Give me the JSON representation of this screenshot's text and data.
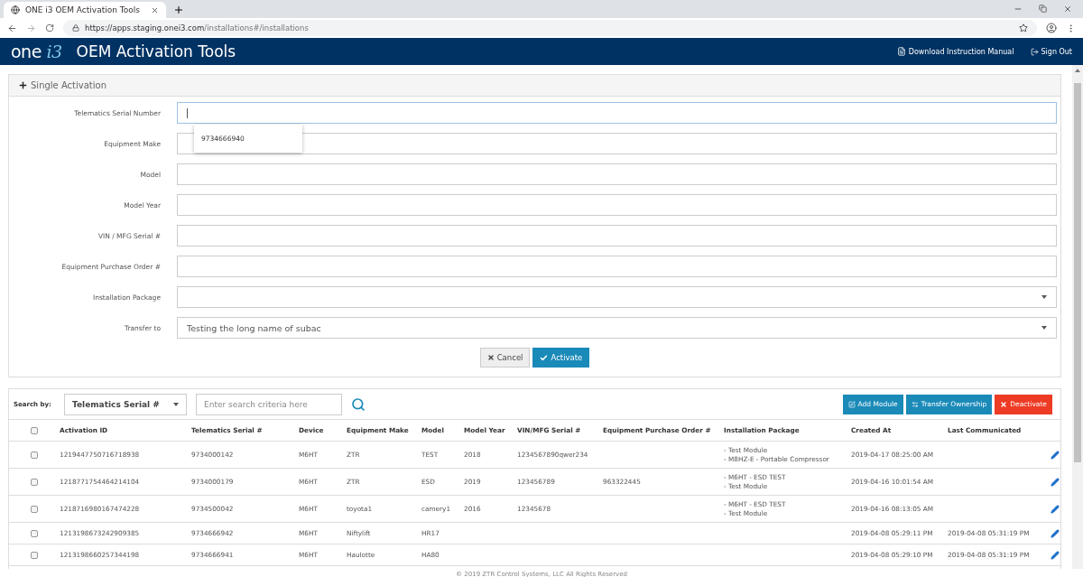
{
  "browser": {
    "tab_title": "ONE i3 OEM Activation Tools",
    "url_host": "https://apps.staging.onei3.com",
    "url_path": "/installations#/installations"
  },
  "header": {
    "logo": {
      "word": "one",
      "mark": "i3"
    },
    "title": "OEM Activation Tools",
    "links": [
      {
        "kind": "pdf",
        "label": "Download Instruction Manual"
      },
      {
        "kind": "signout",
        "label": "Sign Out"
      }
    ]
  },
  "single_activation": {
    "title": "Single Activation",
    "expanded": true,
    "fields": [
      {
        "kind": "text",
        "label": "Telematics Serial Number",
        "focused": true,
        "suggestion": "9734666940"
      },
      {
        "kind": "text",
        "label": "Equipment Make",
        "focused": false
      },
      {
        "kind": "text",
        "label": "Model",
        "focused": false
      },
      {
        "kind": "text",
        "label": "Model Year",
        "focused": false
      },
      {
        "kind": "text",
        "label": "VIN / MFG Serial #",
        "focused": false
      },
      {
        "kind": "text",
        "label": "Equipment Purchase Order #",
        "focused": false
      },
      {
        "kind": "select",
        "label": "Installation Package",
        "focused": false
      },
      {
        "kind": "select",
        "label": "Transfer to",
        "value": "Testing the long name of subac",
        "focused": false
      }
    ],
    "buttons": [
      {
        "kind": "cancel",
        "label": "Cancel"
      },
      {
        "kind": "activate",
        "label": "Activate"
      }
    ]
  },
  "search": {
    "label": "Search by:",
    "field": "Telematics Serial #",
    "placeholder": "Enter search criteria here"
  },
  "actions": [
    {
      "kind": "edit",
      "label": "Add Module",
      "color": "#1a8ab8"
    },
    {
      "kind": "transfer",
      "label": "Transfer Ownership",
      "color": "#1a8ab8"
    },
    {
      "kind": "delete",
      "label": "Deactivate",
      "color": "#ee3b24"
    }
  ],
  "table": {
    "columns": [
      "Activation ID",
      "Telematics Serial #",
      "Device",
      "Equipment Make",
      "Model",
      "Model Year",
      "VIN/MFG Serial #",
      "Equipment Purchase Order #",
      "Installation Package",
      "Created At",
      "Last Communicated"
    ],
    "all_checked": false,
    "rows": [
      {
        "checked": false,
        "cells": [
          "1219447750716718938",
          "9734000142",
          "M6HT",
          "ZTR",
          "TEST",
          "2018",
          "1234567890qwer234",
          "",
          [
            "- Test Module",
            "- M8HZ-E - Portable Compressor"
          ],
          "2019-04-17 08:25:00 AM",
          ""
        ]
      },
      {
        "checked": false,
        "cells": [
          "1218771754464214104",
          "9734000179",
          "M6HT",
          "ZTR",
          "ESD",
          "2019",
          "123456789",
          "963322445",
          [
            "- M6HT - ESD TEST",
            "- Test Module"
          ],
          "2019-04-16 10:01:54 AM",
          ""
        ]
      },
      {
        "checked": false,
        "cells": [
          "1218716980167474228",
          "9734500042",
          "M6HT",
          "toyota1",
          "camery1",
          "2016",
          "12345678",
          "",
          [
            "- M6HT - ESD TEST",
            "- Test Module"
          ],
          "2019-04-16 08:13:05 AM",
          ""
        ]
      },
      {
        "checked": false,
        "cells": [
          "1213198673242909385",
          "9734666942",
          "M6HT",
          "Niftylift",
          "HR17",
          "",
          "",
          "",
          [],
          "2019-04-08 05:29:11 PM",
          "2019-04-08 05:31:19 PM"
        ]
      },
      {
        "checked": false,
        "cells": [
          "1213198660257344198",
          "9734666941",
          "M6HT",
          "Haulotte",
          "HA80",
          "",
          "",
          "",
          [],
          "2019-04-08 05:29:10 PM",
          "2019-04-08 05:31:19 PM"
        ]
      }
    ]
  },
  "footer": "© 2019 ZTR Control Systems, LLC All Rights Reserved"
}
